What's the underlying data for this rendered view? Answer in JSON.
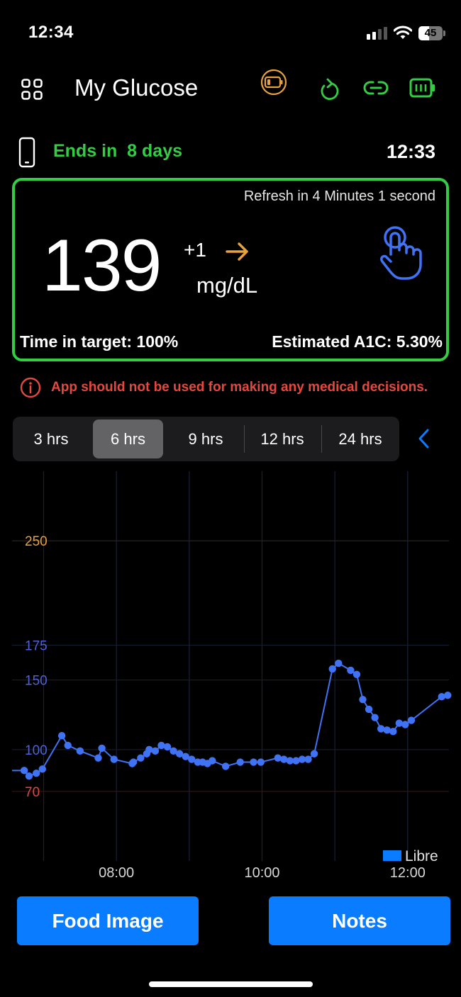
{
  "status_bar": {
    "time": "12:34",
    "battery_percent": 45,
    "battery_label": "45",
    "signal_bars_active": 2,
    "icons": [
      "cellular-signal-icon",
      "wifi-icon",
      "battery-icon"
    ]
  },
  "header": {
    "title": "My Glucose",
    "icons": [
      "grid-menu-icon",
      "sensor-battery-low-icon",
      "refresh-icon",
      "link-icon",
      "battery-full-icon"
    ]
  },
  "sensor": {
    "ends_label": "Ends in  8 days",
    "last_reading_time": "12:33"
  },
  "reading_card": {
    "refresh_text": "Refresh in 4 Minutes 1 second",
    "value": "139",
    "delta": "+1",
    "trend": "steady-arrow-right",
    "unit": "mg/dL",
    "time_in_target": "Time in target: 100%",
    "estimated_a1c": "Estimated A1C: 5.30%"
  },
  "disclaimer": {
    "text": "App should not be used for making any medical decisions."
  },
  "range_selector": {
    "options": [
      "3 hrs",
      "6 hrs",
      "9 hrs",
      "12 hrs",
      "24 hrs"
    ],
    "selected": "6 hrs"
  },
  "colors": {
    "accent_green": "#33cc44",
    "warning_red": "#e5483f",
    "high_orange": "#e8a23c",
    "series_blue": "#3f72f5",
    "button_blue": "#0a7cff",
    "tick_blue": "#4d63d6"
  },
  "chart_data": {
    "type": "line",
    "title": "",
    "xlabel": "",
    "ylabel": "",
    "x_range": [
      "06:34",
      "12:34"
    ],
    "ylim": [
      20,
      300
    ],
    "x_ticks": [
      "08:00",
      "10:00",
      "12:00"
    ],
    "x_gridlines": [
      "07:00",
      "08:00",
      "09:00",
      "10:00",
      "11:00",
      "12:00"
    ],
    "y_ticks": [
      {
        "value": 250,
        "label": "250",
        "color": "#e8a23c"
      },
      {
        "value": 175,
        "label": "175",
        "color": "#4d63d6"
      },
      {
        "value": 150,
        "label": "150",
        "color": "#4d63d6"
      },
      {
        "value": 100,
        "label": "100",
        "color": "#4d63d6"
      },
      {
        "value": 70,
        "label": "70",
        "color": "#e5483f"
      }
    ],
    "grid": true,
    "legend": {
      "position": "bottom-right",
      "entries": [
        {
          "name": "Libre",
          "color": "#0a7cff"
        }
      ]
    },
    "series": [
      {
        "name": "Libre",
        "line_start": {
          "x": "06:34",
          "y": 85
        },
        "points": [
          {
            "x": "06:44",
            "y": 85
          },
          {
            "x": "06:48",
            "y": 81
          },
          {
            "x": "06:54",
            "y": 83
          },
          {
            "x": "06:59",
            "y": 86
          },
          {
            "x": "07:15",
            "y": 110
          },
          {
            "x": "07:20",
            "y": 103
          },
          {
            "x": "07:30",
            "y": 99
          },
          {
            "x": "07:45",
            "y": 94
          },
          {
            "x": "07:48",
            "y": 101
          },
          {
            "x": "07:58",
            "y": 93
          },
          {
            "x": "08:13",
            "y": 90
          },
          {
            "x": "08:14",
            "y": 91
          },
          {
            "x": "08:20",
            "y": 94
          },
          {
            "x": "08:25",
            "y": 97
          },
          {
            "x": "08:27",
            "y": 100
          },
          {
            "x": "08:32",
            "y": 99
          },
          {
            "x": "08:37",
            "y": 103
          },
          {
            "x": "08:42",
            "y": 102
          },
          {
            "x": "08:47",
            "y": 99
          },
          {
            "x": "08:52",
            "y": 97
          },
          {
            "x": "08:57",
            "y": 95
          },
          {
            "x": "09:02",
            "y": 93
          },
          {
            "x": "09:07",
            "y": 91
          },
          {
            "x": "09:11",
            "y": 91
          },
          {
            "x": "09:15",
            "y": 90
          },
          {
            "x": "09:19",
            "y": 92
          },
          {
            "x": "09:30",
            "y": 88
          },
          {
            "x": "09:42",
            "y": 91
          },
          {
            "x": "09:53",
            "y": 91
          },
          {
            "x": "09:59",
            "y": 91
          },
          {
            "x": "10:13",
            "y": 94
          },
          {
            "x": "10:18",
            "y": 93
          },
          {
            "x": "10:23",
            "y": 92
          },
          {
            "x": "10:28",
            "y": 92
          },
          {
            "x": "10:33",
            "y": 93
          },
          {
            "x": "10:38",
            "y": 93
          },
          {
            "x": "10:43",
            "y": 97
          },
          {
            "x": "10:58",
            "y": 158
          },
          {
            "x": "11:03",
            "y": 162
          },
          {
            "x": "11:13",
            "y": 157
          },
          {
            "x": "11:18",
            "y": 154
          },
          {
            "x": "11:23",
            "y": 136
          },
          {
            "x": "11:28",
            "y": 129
          },
          {
            "x": "11:33",
            "y": 123
          },
          {
            "x": "11:38",
            "y": 115
          },
          {
            "x": "11:43",
            "y": 114
          },
          {
            "x": "11:48",
            "y": 113
          },
          {
            "x": "11:53",
            "y": 119
          },
          {
            "x": "11:58",
            "y": 118
          },
          {
            "x": "12:03",
            "y": 121
          },
          {
            "x": "12:28",
            "y": 138
          },
          {
            "x": "12:33",
            "y": 139
          }
        ]
      }
    ]
  },
  "actions": {
    "food_image_label": "Food Image",
    "notes_label": "Notes"
  }
}
